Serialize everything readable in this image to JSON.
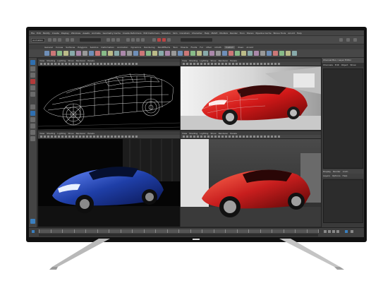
{
  "app": {
    "menu": [
      "File",
      "Edit",
      "Modify",
      "Create",
      "Display",
      "Windows",
      "Assets",
      "Animate",
      "Geometry Cache",
      "Create Deformers",
      "Edit Deformers",
      "Skeleton",
      "Skin",
      "Constrain",
      "Character",
      "Help",
      "MASH",
      "Mudbox",
      "Render",
      "Toon",
      "Stereo",
      "Pipeline Cache",
      "Bonus Tools",
      "Arnold",
      "Help"
    ],
    "mode": "Animation",
    "shelf_tabs": [
      "General",
      "Curves",
      "Surfaces",
      "Polygons",
      "Subdivs",
      "Deformation",
      "Animation",
      "Dynamics",
      "Rendering",
      "PaintEffects",
      "Toon",
      "Muscle",
      "Fluids",
      "Fur",
      "nHair",
      "nCloth",
      "Custom",
      "XGen",
      "Arnold"
    ],
    "active_shelf_tab": "Custom",
    "viewport_menu": [
      "View",
      "Shading",
      "Lighting",
      "Show",
      "Renderer",
      "Panels"
    ]
  },
  "viewports": [
    {
      "name": "wireframe"
    },
    {
      "name": "shaded-red-wireframe"
    },
    {
      "name": "blue-render"
    },
    {
      "name": "red-render"
    }
  ],
  "right_panel": {
    "title": "Channel Box / Layer Editor",
    "tabs": [
      "Channels",
      "Edit",
      "Object",
      "Show"
    ],
    "lower_tabs": [
      "Display",
      "Render",
      "Anim"
    ],
    "lower_tabs2": [
      "Layers",
      "Options",
      "Help"
    ]
  },
  "colors": {
    "ui_bg": "#3c3c3c",
    "bezel": "#101010",
    "car_blue": "#1f3fa8",
    "car_red": "#c81e1e"
  }
}
